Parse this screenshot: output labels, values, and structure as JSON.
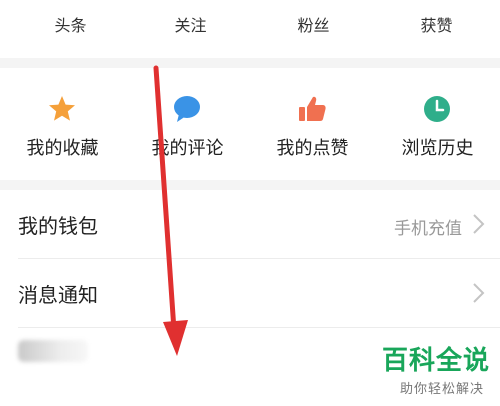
{
  "stats": {
    "items": [
      {
        "label": "头条"
      },
      {
        "label": "关注"
      },
      {
        "label": "粉丝"
      },
      {
        "label": "获赞"
      }
    ]
  },
  "quick_actions": {
    "items": [
      {
        "label": "我的收藏",
        "icon": "star-icon",
        "color": "#f5a03a"
      },
      {
        "label": "我的评论",
        "icon": "comment-icon",
        "color": "#3a93e6"
      },
      {
        "label": "我的点赞",
        "icon": "thumbs-up-icon",
        "color": "#f07050"
      },
      {
        "label": "浏览历史",
        "icon": "clock-icon",
        "color": "#2fae8a"
      }
    ]
  },
  "menu": {
    "wallet": {
      "label": "我的钱包",
      "value": "手机充值"
    },
    "notifications": {
      "label": "消息通知"
    },
    "mini_program": {
      "label": ""
    }
  },
  "watermark": {
    "title": "百科全说",
    "subtitle": "助你轻松解决"
  },
  "colors": {
    "arrow": "#e03030",
    "brand": "#19a65a"
  }
}
